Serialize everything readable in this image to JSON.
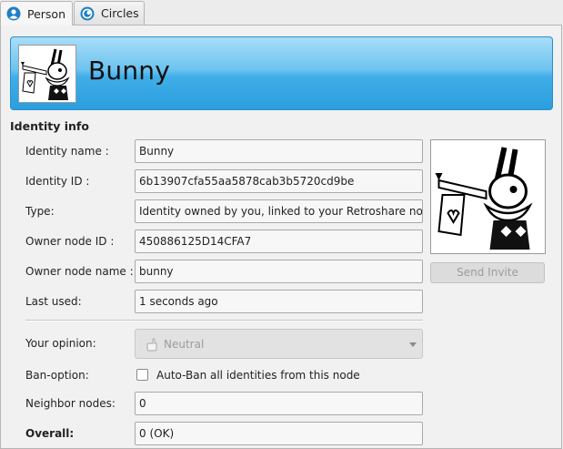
{
  "tabs": [
    {
      "label": "Person",
      "active": true,
      "icon": "person-icon"
    },
    {
      "label": "Circles",
      "active": false,
      "icon": "circles-icon"
    }
  ],
  "header": {
    "name": "Bunny",
    "avatar": "bunny-avatar-image"
  },
  "identity_info": {
    "title": "Identity info",
    "fields": [
      {
        "label": "Identity name :",
        "value": "Bunny"
      },
      {
        "label": "Identity ID :",
        "value": "6b13907cfa55aa5878cab3b5720cd9be"
      },
      {
        "label": "Type:",
        "value": "Identity owned by you, linked to your Retroshare node"
      },
      {
        "label": "Owner node ID :",
        "value": "450886125D14CFA7"
      },
      {
        "label": "Owner node name :",
        "value": "bunny"
      },
      {
        "label": "Last used:",
        "value": "1 seconds ago"
      }
    ],
    "opinion": {
      "label": "Your opinion:",
      "value": "Neutral",
      "icon": "hand-icon",
      "enabled": false
    },
    "ban_option": {
      "label": "Ban-option:",
      "checkbox_label": "Auto-Ban all identities from this node",
      "checked": false
    },
    "neighbor_nodes": {
      "label": "Neighbor nodes:",
      "value": "0"
    },
    "overall": {
      "label": "Overall:",
      "value": "0 (OK)"
    },
    "send_invite_label": "Send Invite"
  },
  "colors": {
    "banner_top": "#a9ddf8",
    "banner_bottom": "#2a9ede",
    "tab_icon": "#1f7fc6"
  }
}
